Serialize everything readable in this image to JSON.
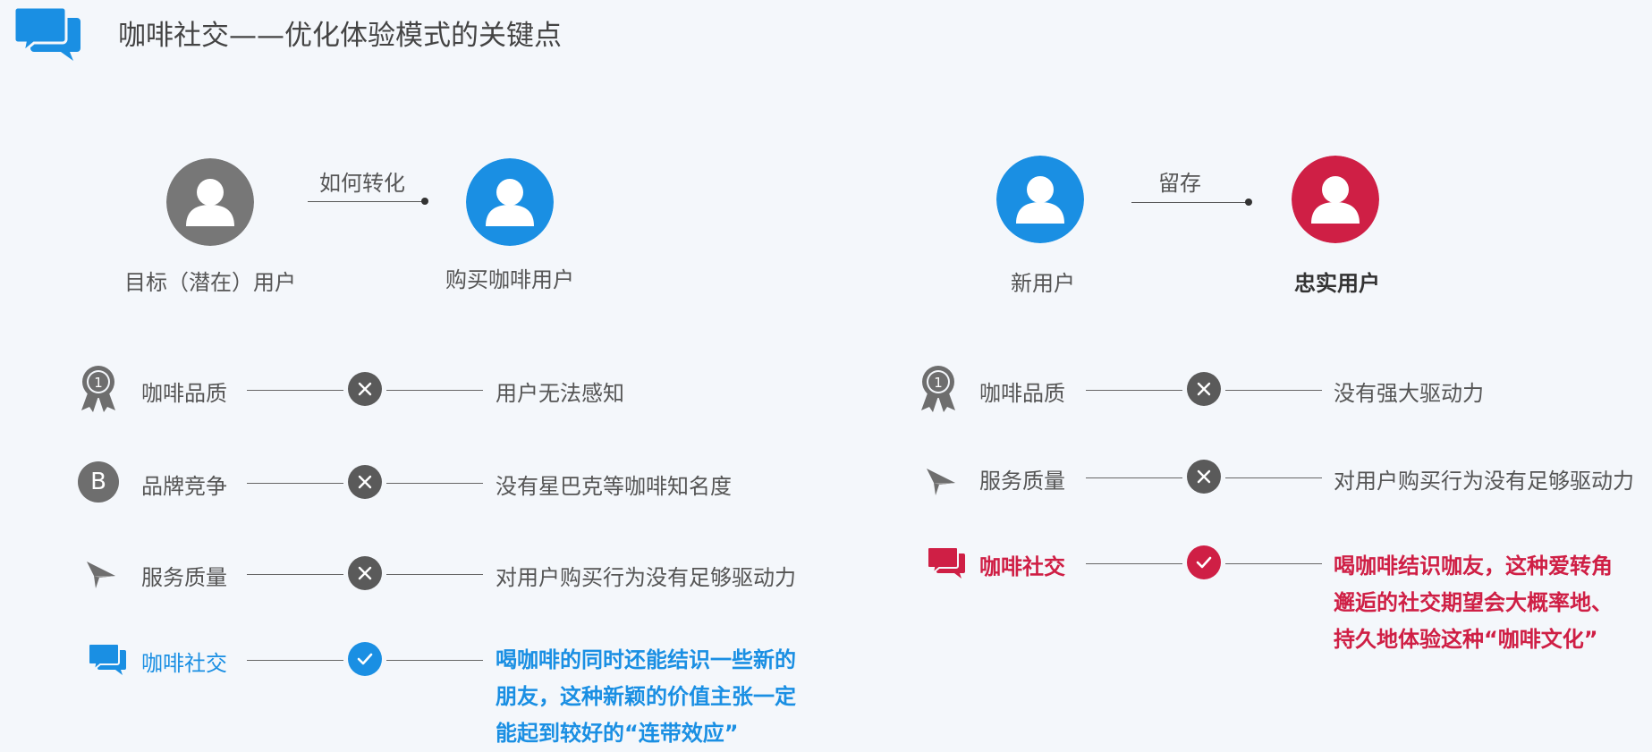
{
  "header": {
    "title": "咖啡社交——优化体验模式的关键点",
    "icon": "chat-bubbles-icon",
    "icon_color": "#1a8fe3"
  },
  "colors": {
    "blue": "#1a8fe3",
    "red": "#cf1f45",
    "gray": "#777777",
    "dark_gray": "#5a5a5a"
  },
  "left_flow": {
    "from_label": "目标（潜在）用户",
    "to_label": "购买咖啡用户",
    "arrow_label": "如何转化",
    "rows": [
      {
        "icon": "award-medal-icon",
        "factor": "咖啡品质",
        "status": "cross",
        "result": "用户无法感知"
      },
      {
        "icon": "brand-b-icon",
        "icon_text": "B",
        "factor": "品牌竞争",
        "status": "cross",
        "result": "没有星巴克等咖啡知名度"
      },
      {
        "icon": "paper-plane-icon",
        "factor": "服务质量",
        "status": "cross",
        "result": "对用户购买行为没有足够驱动力"
      },
      {
        "icon": "chat-bubbles-icon",
        "factor": "咖啡社交",
        "status": "check",
        "result_lines": [
          "喝咖啡的同时还能结识一些新的",
          "朋友，这种新颖的价值主张一定",
          "能起到较好的“连带效应”"
        ]
      }
    ]
  },
  "right_flow": {
    "from_label": "新用户",
    "to_label": "忠实用户",
    "arrow_label": "留存",
    "rows": [
      {
        "icon": "award-medal-icon",
        "factor": "咖啡品质",
        "status": "cross",
        "result": "没有强大驱动力"
      },
      {
        "icon": "paper-plane-icon",
        "factor": "服务质量",
        "status": "cross",
        "result": "对用户购买行为没有足够驱动力"
      },
      {
        "icon": "chat-bubbles-icon",
        "factor": "咖啡社交",
        "status": "check",
        "result_lines": [
          "喝咖啡结识咖友，这种爱转角",
          "邂逅的社交期望会大概率地、",
          "持久地体验这种“咖啡文化”"
        ]
      }
    ]
  }
}
